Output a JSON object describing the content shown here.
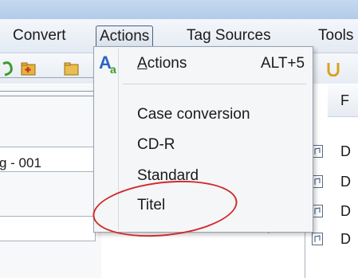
{
  "menubar": {
    "items": [
      {
        "label": "Convert"
      },
      {
        "label": "Actions",
        "open": true
      },
      {
        "label": "Tag Sources"
      },
      {
        "label": "Tools"
      }
    ]
  },
  "toolbar": {
    "icons": [
      "green-toolbar-icon",
      "add-folder-icon",
      "folder-icon",
      "yellow-toolbar-icon"
    ]
  },
  "left_panel": {
    "field_value": "g - 001"
  },
  "file_list": {
    "header": "F",
    "rows": [
      "D",
      "D",
      "D",
      "D"
    ]
  },
  "actions_menu": {
    "items": [
      {
        "label": "Actions",
        "mnemonic": "A",
        "rest": "ctions",
        "shortcut": "ALT+5",
        "icon": "actions-icon"
      },
      {
        "label": "Case conversion"
      },
      {
        "label": "CD-R"
      },
      {
        "label": "Standard"
      },
      {
        "label": "Titel"
      }
    ]
  },
  "colors": {
    "annotation": "#d02c2c",
    "menu_bg": "#f5f6f7",
    "accent_blue": "#2a64c5"
  }
}
